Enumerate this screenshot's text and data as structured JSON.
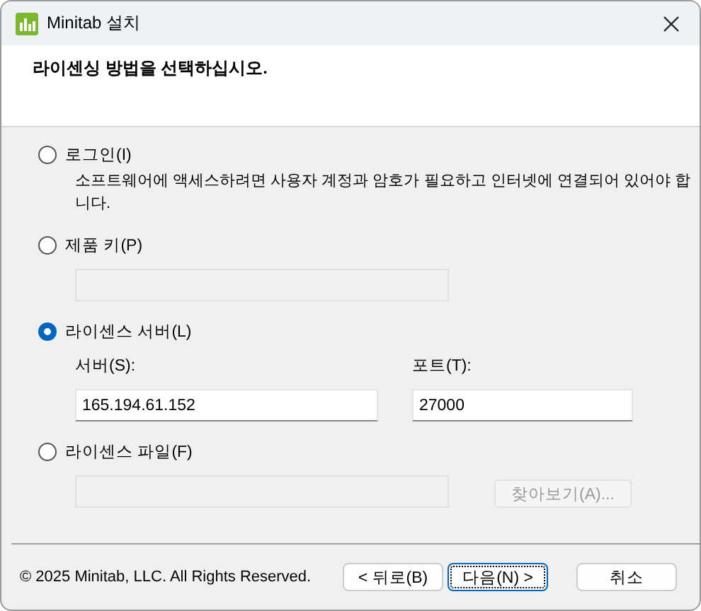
{
  "window": {
    "title": "Minitab 설치"
  },
  "header": {
    "heading": "라이센싱 방법을 선택하십시오."
  },
  "options": [
    {
      "label": "로그인(I)",
      "selected": false,
      "description": "소프트웨어에 액세스하려면 사용자 계정과 암호가 필요하고 인터넷에 연결되어 있어야 합니다."
    },
    {
      "label": "제품 키(P)",
      "selected": false,
      "fields": [
        {
          "disabled": true
        }
      ]
    },
    {
      "label": "라이센스 서버(L)",
      "selected": true,
      "fields": [
        {
          "label": "서버(S):",
          "value": "165.194.61.152",
          "disabled": false
        },
        {
          "label": "포트(T):",
          "value": "27000",
          "disabled": false
        }
      ]
    },
    {
      "label": "라이센스 파일(F)",
      "selected": false,
      "fields": [
        {
          "disabled": true
        }
      ],
      "browse": {
        "label": "찾아보기(A)...",
        "disabled": true
      }
    }
  ],
  "footer": {
    "copyright": "© 2025 Minitab, LLC. All Rights Reserved.",
    "buttons": [
      {
        "label": "< 뒤로(B)",
        "focused": false
      },
      {
        "label": "다음(N) >",
        "focused": true
      },
      {
        "label": "취소",
        "focused": false
      }
    ]
  }
}
